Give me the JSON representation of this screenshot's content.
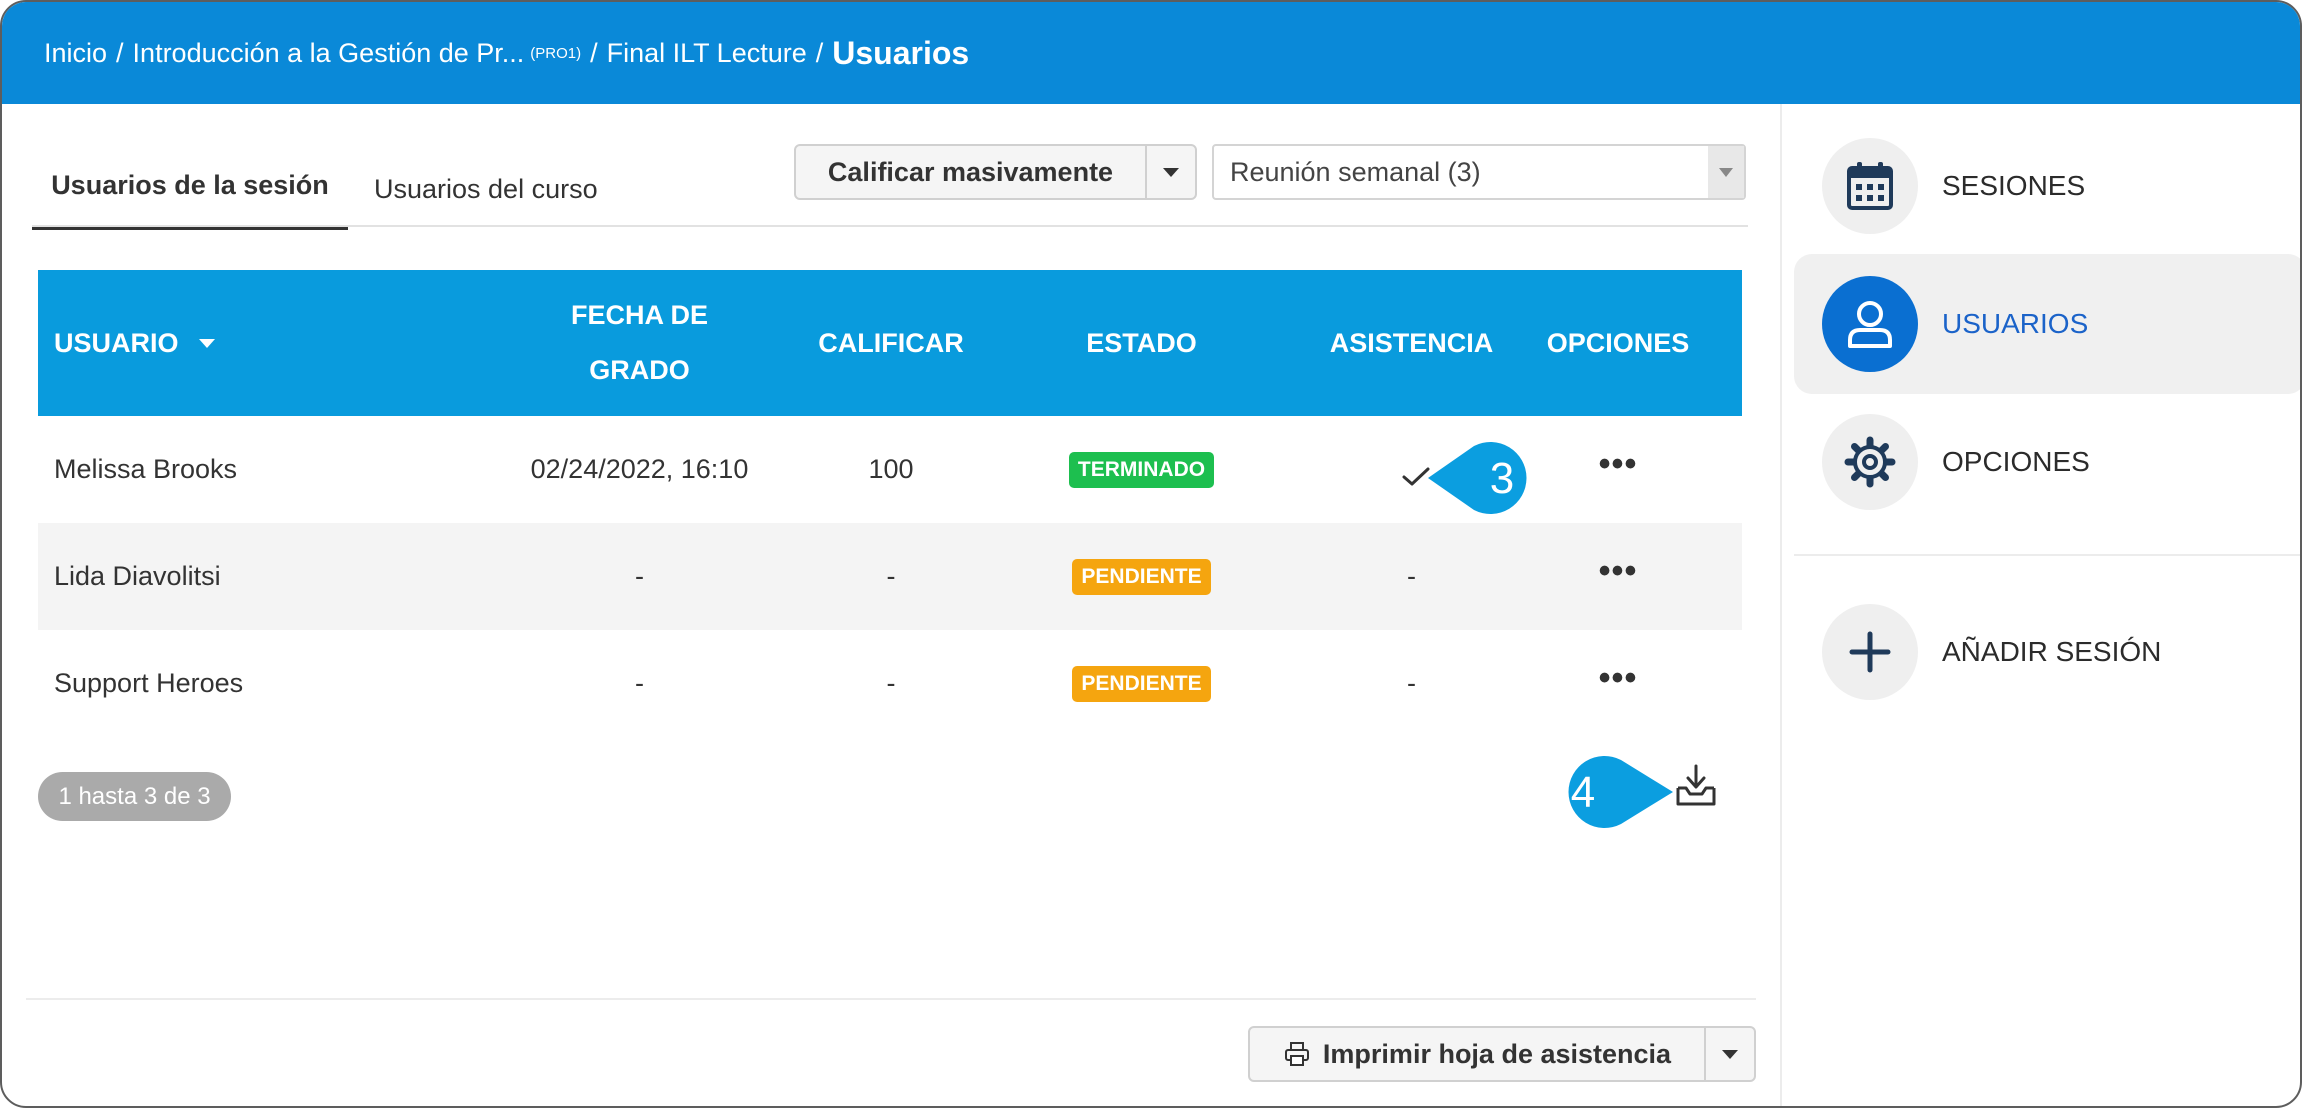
{
  "breadcrumb": {
    "home": "Inicio",
    "course": "Introducción a la Gestión de Pr...",
    "course_code": "(PRO1)",
    "lecture": "Final ILT Lecture",
    "current": "Usuarios"
  },
  "tabs": {
    "session_users": "Usuarios de la sesión",
    "course_users": "Usuarios del curso"
  },
  "toolbar": {
    "bulk_grade_label": "Calificar masivamente",
    "session_select_value": "Reunión semanal (3)"
  },
  "table": {
    "columns": {
      "user": "USUARIO",
      "grade_date_line1": "FECHA DE",
      "grade_date_line2": "GRADO",
      "grade": "CALIFICAR",
      "status": "ESTADO",
      "attendance": "ASISTENCIA",
      "options": "OPCIONES"
    },
    "rows": [
      {
        "user": "Melissa Brooks",
        "date": "02/24/2022, 16:10",
        "grade": "100",
        "status": "TERMINADO",
        "attendance": "✓",
        "options": "•••"
      },
      {
        "user": "Lida Diavolitsi",
        "date": "-",
        "grade": "-",
        "status": "PENDIENTE",
        "attendance": "-",
        "options": "•••"
      },
      {
        "user": "Support Heroes",
        "date": "-",
        "grade": "-",
        "status": "PENDIENTE",
        "attendance": "-",
        "options": "•••"
      }
    ]
  },
  "pagination": {
    "summary": "1 hasta 3 de 3"
  },
  "callouts": {
    "three": "3",
    "four": "4"
  },
  "footer": {
    "print_label": "Imprimir hoja de asistencia"
  },
  "sidebar": {
    "items": [
      {
        "label": "SESIONES",
        "icon": "calendar-icon"
      },
      {
        "label": "USUARIOS",
        "icon": "user-icon",
        "active": true
      },
      {
        "label": "OPCIONES",
        "icon": "gear-icon"
      }
    ],
    "add_label": "AÑADIR SESIÓN",
    "add_icon": "plus-icon"
  },
  "colors": {
    "header_bar": "#0a89d8",
    "table_header": "#099bdd",
    "status_done": "#1dbf4f",
    "status_pending": "#f5a50f",
    "active_nav": "#0a6fd1",
    "callout": "#0b9ee0"
  }
}
